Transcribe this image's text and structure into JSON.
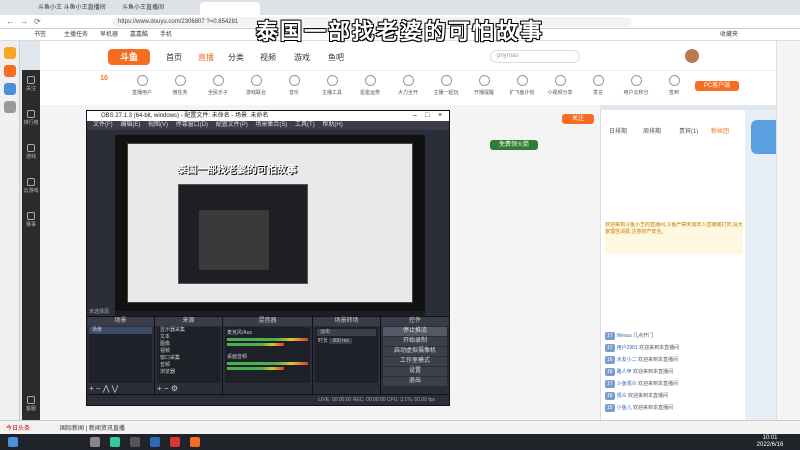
{
  "overlay_title": "泰国一部找老婆的可怕故事",
  "browser": {
    "tabs": [
      "斗鱼小王 斗鱼小王直播间",
      "斗鱼小王直播间"
    ],
    "url": "https://www.douyu.com/2306807 ?=0.854281",
    "bookmarks": [
      "书签",
      "主播任务",
      "早机器",
      "嘉嘉酷",
      "手机",
      "收藏夹"
    ]
  },
  "site": {
    "logo": "斗鱼",
    "nav": [
      "首页",
      "直播",
      "分类",
      "视频",
      "游戏",
      "鱼吧"
    ],
    "active_nav": "直播",
    "search_placeholder": "pnyrnas",
    "left_nav": [
      "关注",
      "排行榜",
      "游戏",
      "云游戏",
      "赛事",
      "客服"
    ],
    "categories": [
      "10",
      "直播用户",
      "微任务",
      "全民乐子",
      "游戏联合",
      "音乐",
      "主播工具",
      "星座运势",
      "大力全开",
      "主播一起玩",
      "开播提醒",
      "扩飞鱼计划",
      "小视频分享",
      "发言",
      "用户云积分",
      "签到",
      "更多"
    ],
    "pc_client_label": "PC客户端",
    "follow_label": "关注",
    "hot_label": "免费领火箭"
  },
  "chat": {
    "tabs": [
      "日排期",
      "周排期",
      "贵宾(1)",
      "粉丝团"
    ],
    "active_tab": "贵宾(1)",
    "messages": [
      {
        "level": "17",
        "user": "Wesus",
        "text": "几点开门"
      },
      {
        "level": "17",
        "user": "用户2981",
        "text": "欢迎来到本直播间"
      },
      {
        "level": "16",
        "user": "水友小二",
        "text": "欢迎来到本直播间"
      },
      {
        "level": "16",
        "user": "路人甲",
        "text": "欢迎来到本直播间"
      },
      {
        "level": "17",
        "user": "斗鱼观众",
        "text": "欢迎来到本直播间"
      },
      {
        "level": "16",
        "user": "观众",
        "text": "欢迎来到本直播间"
      },
      {
        "level": "15",
        "user": "小鱼儿",
        "text": "欢迎来到本直播间"
      }
    ],
    "notice": "欢迎来到斗鱼小王的直播间,斗鱼严禁未成年人直播或打赏,请大家理性消费,注意财产安全。"
  },
  "obs": {
    "title": "OBS 27.1.3 (64-bit, windows) - 配置文件: 未命名 - 场景: 未命名",
    "menu": [
      "文件(F)",
      "编辑(E)",
      "视图(V)",
      "停靠窗口(D)",
      "配置文件(P)",
      "场景集合(S)",
      "工具(T)",
      "帮助(H)"
    ],
    "preview_caption": "泰国一部找老婆的可怕故事",
    "scene_label": "未选择源",
    "docks": {
      "scenes": {
        "header": "场景",
        "items": [
          "场景"
        ]
      },
      "sources": {
        "header": "来源",
        "items": [
          "显示器采集",
          "文本",
          "图像",
          "视频",
          "窗口采集",
          "音频",
          "浏览器"
        ]
      },
      "mixer": {
        "header": "混音器",
        "channels": [
          "麦克风/Aux",
          "桌面音频"
        ]
      },
      "transitions": {
        "header": "场景转场",
        "type": "淡出",
        "duration_label": "时长",
        "duration": "300 ms"
      },
      "controls": {
        "header": "控件",
        "buttons": [
          "停止推流",
          "开始录制",
          "启动虚拟摄像机",
          "工作室模式",
          "设置",
          "退出"
        ]
      }
    },
    "statusbar": "LIVE: 00:00:00   REC: 00:00:00   CPU: 3.1%, 60.00 fps"
  },
  "taskbar": {
    "left_text": "今日头条",
    "news": "国际新闻 | 新闻资讯直播",
    "time": "10:01",
    "date": "2022/6/16"
  }
}
